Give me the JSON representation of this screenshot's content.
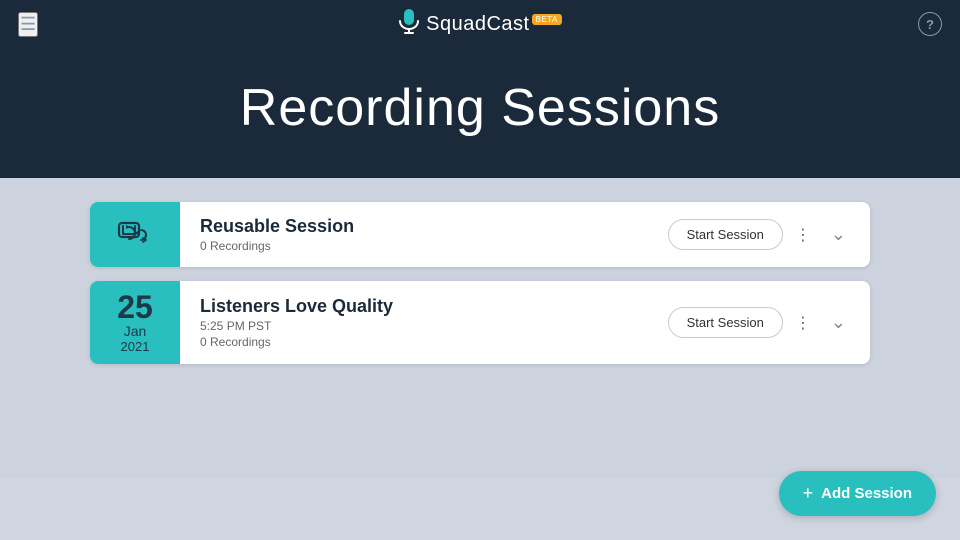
{
  "header": {
    "menu_icon": "☰",
    "logo_brand": "Squad",
    "logo_end": "Cast",
    "beta_label": "BETA",
    "help_icon": "?"
  },
  "page": {
    "title": "Recording Sessions"
  },
  "sessions": [
    {
      "id": "reusable",
      "type": "reusable",
      "name": "Reusable Session",
      "recordings_label": "0 Recordings",
      "start_btn": "Start Session"
    },
    {
      "id": "scheduled",
      "type": "scheduled",
      "name": "Listeners Love Quality",
      "date_day": "25",
      "date_month": "Jan",
      "date_year": "2021",
      "time": "5:25 PM PST",
      "recordings_label": "0 Recordings",
      "start_btn": "Start Session"
    }
  ],
  "add_session": {
    "label": "Add Session",
    "plus": "+"
  }
}
